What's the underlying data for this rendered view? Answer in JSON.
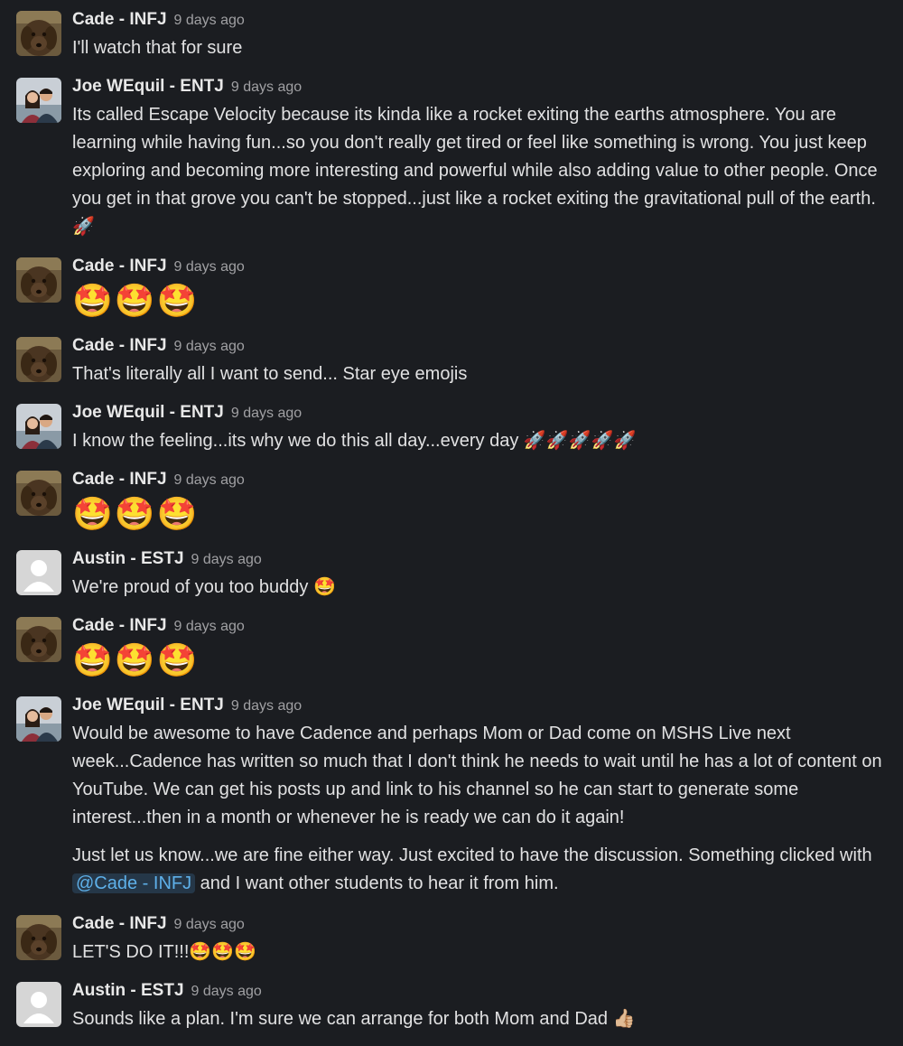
{
  "messages": [
    {
      "author": "Cade - INFJ",
      "time": "9 days ago",
      "text": "I'll watch that for sure"
    },
    {
      "author": "Joe WEquil - ENTJ",
      "time": "9 days ago",
      "text": "Its called Escape Velocity because its kinda like a rocket exiting the earths atmosphere. You are learning while having fun...so you don't really get tired or feel like something is wrong. You just keep exploring and becoming more interesting and powerful while also adding value to other people. Once you get in that grove you can't be stopped...just like a rocket exiting the gravitational pull of the earth.",
      "emoji": "🚀"
    },
    {
      "author": "Cade - INFJ",
      "time": "9 days ago",
      "emoji": "🤩🤩🤩"
    },
    {
      "author": "Cade - INFJ",
      "time": "9 days ago",
      "text": "That's literally all I want to send... Star eye emojis"
    },
    {
      "author": "Joe WEquil - ENTJ",
      "time": "9 days ago",
      "text": "I know the feeling...its why we do this all day...every day",
      "emoji": "🚀🚀🚀🚀🚀"
    },
    {
      "author": "Cade - INFJ",
      "time": "9 days ago",
      "emoji": "🤩🤩🤩"
    },
    {
      "author": "Austin - ESTJ",
      "time": "9 days ago",
      "text": "We're proud of you too buddy",
      "emoji": "🤩"
    },
    {
      "author": "Cade - INFJ",
      "time": "9 days ago",
      "emoji": "🤩🤩🤩"
    },
    {
      "author": "Joe WEquil - ENTJ",
      "time": "9 days ago",
      "text": "Would be awesome to have Cadence and perhaps Mom or Dad come on MSHS Live next week...Cadence has written so much that I don't think he needs to wait until he has a lot of content on YouTube. We can get his posts up and link to his channel so he can start to generate some interest...then in a month or whenever he is ready we can do it again!",
      "text2_before": "Just let us know...we are fine either way. Just excited to have the discussion. Something clicked with ",
      "mention": "@Cade - INFJ",
      "text2_after": " and I want other students to hear it from him."
    },
    {
      "author": "Cade - INFJ",
      "time": "9 days ago",
      "text": "LET'S DO IT!!!",
      "emoji": "🤩🤩🤩"
    },
    {
      "author": "Austin - ESTJ",
      "time": "9 days ago",
      "text": "Sounds like a plan. I'm sure we can arrange for both Mom and Dad",
      "emoji": "👍🏼"
    }
  ]
}
